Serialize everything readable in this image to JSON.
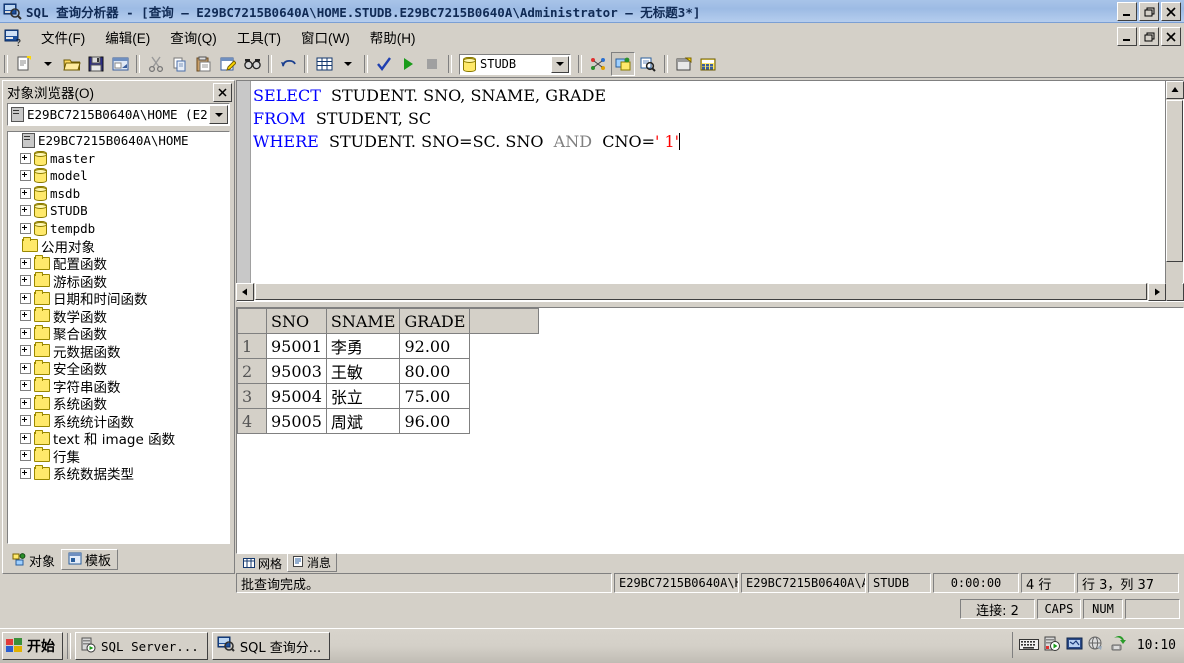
{
  "window": {
    "title": "SQL 查询分析器 - [查询 — E29BC7215B0640A\\HOME.STUDB.E29BC7215B0640A\\Administrator — 无标题3*]",
    "app_icon": "sql-query-analyzer-icon",
    "minimize_label": "_",
    "maximize_label": "❐",
    "close_label": "✕"
  },
  "menubar": {
    "doc_icon": "query-document-icon",
    "items": [
      {
        "label": "文件(F)",
        "accel": "F"
      },
      {
        "label": "编辑(E)",
        "accel": "E"
      },
      {
        "label": "查询(Q)",
        "accel": "Q"
      },
      {
        "label": "工具(T)",
        "accel": "T"
      },
      {
        "label": "窗口(W)",
        "accel": "W"
      },
      {
        "label": "帮助(H)",
        "accel": "H"
      }
    ],
    "mdi_minimize": "_",
    "mdi_restore": "❐",
    "mdi_close": "✕"
  },
  "toolbar": {
    "database_combo_value": "STUDB",
    "buttons": [
      "new-query-icon",
      "new-query-dropdown-icon",
      "open-file-icon",
      "save-icon",
      "insert-template-icon",
      "cut-icon",
      "copy-icon",
      "paste-icon",
      "clear-window-icon",
      "find-icon",
      "undo-icon",
      "results-grid-icon",
      "results-dropdown-icon",
      "parse-query-icon",
      "execute-query-icon",
      "cancel-query-icon",
      "display-estimated-plan-icon",
      "manage-indexes-icon",
      "show-server-trace-icon",
      "object-browser-icon",
      "object-search-icon"
    ]
  },
  "object_browser": {
    "title": "对象浏览器(O)",
    "close_label": "✕",
    "connection": "E29BC7215B0640A\\HOME (E2",
    "tree": [
      {
        "label": "E29BC7215B0640A\\HOME",
        "icon": "server-icon",
        "expandable": false,
        "indent": 0,
        "cjk": false
      },
      {
        "label": "master",
        "icon": "database-icon",
        "expandable": true,
        "indent": 1,
        "cjk": false
      },
      {
        "label": "model",
        "icon": "database-icon",
        "expandable": true,
        "indent": 1,
        "cjk": false
      },
      {
        "label": "msdb",
        "icon": "database-icon",
        "expandable": true,
        "indent": 1,
        "cjk": false
      },
      {
        "label": "STUDB",
        "icon": "database-icon",
        "expandable": true,
        "indent": 1,
        "cjk": false
      },
      {
        "label": "tempdb",
        "icon": "database-icon",
        "expandable": true,
        "indent": 1,
        "cjk": false
      },
      {
        "label": "公用对象",
        "icon": "folder-icon",
        "expandable": false,
        "indent": 0,
        "cjk": true
      },
      {
        "label": "配置函数",
        "icon": "folder-icon",
        "expandable": true,
        "indent": 1,
        "cjk": true
      },
      {
        "label": "游标函数",
        "icon": "folder-icon",
        "expandable": true,
        "indent": 1,
        "cjk": true
      },
      {
        "label": "日期和时间函数",
        "icon": "folder-icon",
        "expandable": true,
        "indent": 1,
        "cjk": true
      },
      {
        "label": "数学函数",
        "icon": "folder-icon",
        "expandable": true,
        "indent": 1,
        "cjk": true
      },
      {
        "label": "聚合函数",
        "icon": "folder-icon",
        "expandable": true,
        "indent": 1,
        "cjk": true
      },
      {
        "label": "元数据函数",
        "icon": "folder-icon",
        "expandable": true,
        "indent": 1,
        "cjk": true
      },
      {
        "label": "安全函数",
        "icon": "folder-icon",
        "expandable": true,
        "indent": 1,
        "cjk": true
      },
      {
        "label": "字符串函数",
        "icon": "folder-icon",
        "expandable": true,
        "indent": 1,
        "cjk": true
      },
      {
        "label": "系统函数",
        "icon": "folder-icon",
        "expandable": true,
        "indent": 1,
        "cjk": true
      },
      {
        "label": "系统统计函数",
        "icon": "folder-icon",
        "expandable": true,
        "indent": 1,
        "cjk": true
      },
      {
        "label": "text 和 image 函数",
        "icon": "folder-icon",
        "expandable": true,
        "indent": 1,
        "cjk": true
      },
      {
        "label": "行集",
        "icon": "folder-icon",
        "expandable": true,
        "indent": 1,
        "cjk": true
      },
      {
        "label": "系统数据类型",
        "icon": "folder-icon",
        "expandable": true,
        "indent": 1,
        "cjk": true
      }
    ],
    "tabs": [
      {
        "label": "对象",
        "icon": "objects-icon",
        "active": false
      },
      {
        "label": "模板",
        "icon": "templates-icon",
        "active": true
      }
    ]
  },
  "editor": {
    "lines": [
      {
        "parts": [
          {
            "t": "SELECT",
            "c": "kw"
          },
          {
            "t": "  STUDENT. SNO, SNAME, GRADE",
            "c": ""
          }
        ]
      },
      {
        "parts": [
          {
            "t": "FROM",
            "c": "kw"
          },
          {
            "t": "  STUDENT, SC",
            "c": ""
          }
        ]
      },
      {
        "parts": [
          {
            "t": "WHERE",
            "c": "kw"
          },
          {
            "t": "  STUDENT. SNO=SC. SNO  ",
            "c": ""
          },
          {
            "t": "AND",
            "c": "kw2"
          },
          {
            "t": "  CNO=",
            "c": ""
          },
          {
            "t": "' 1'",
            "c": "str"
          }
        ]
      }
    ],
    "keyword_color": "#0000ff",
    "operator_color": "#808080",
    "string_color": "#ff0000"
  },
  "results": {
    "columns": [
      "",
      "SNO",
      "SNAME",
      "GRADE",
      ""
    ],
    "rows": [
      {
        "num": "1",
        "SNO": "95001",
        "SNAME": "李勇",
        "GRADE": "92.00"
      },
      {
        "num": "2",
        "SNO": "95003",
        "SNAME": "王敏",
        "GRADE": "80.00"
      },
      {
        "num": "3",
        "SNO": "95004",
        "SNAME": "张立",
        "GRADE": "75.00"
      },
      {
        "num": "4",
        "SNO": "95005",
        "SNAME": "周斌",
        "GRADE": "96.00"
      }
    ],
    "tabs": [
      {
        "label": "网格",
        "icon": "grid-icon",
        "active": false
      },
      {
        "label": "消息",
        "icon": "messages-icon",
        "active": true
      }
    ]
  },
  "statusbar": {
    "message": "批查询完成。",
    "server": "E29BC7215B0640A\\H(",
    "user": "E29BC7215B0640A\\A(",
    "database": "STUDB",
    "elapsed": "0:00:00",
    "rowcount": "4 行",
    "position": "行 3，列 37",
    "connections": "连接: 2",
    "caps": "CAPS",
    "num": "NUM"
  },
  "taskbar": {
    "start_label": "开始",
    "start_icon": "windows-flag-icon",
    "tasks": [
      {
        "label": "SQL Server...",
        "icon": "sql-server-service-icon",
        "cjk": false
      },
      {
        "label": "SQL 查询分...",
        "icon": "sql-query-analyzer-icon",
        "cjk": true
      }
    ],
    "tray_icons": [
      "keyboard-layout-icon",
      "sql-server-service-manager-icon",
      "volume-icon",
      "network-icon",
      "update-icon"
    ],
    "clock": "10:10"
  }
}
